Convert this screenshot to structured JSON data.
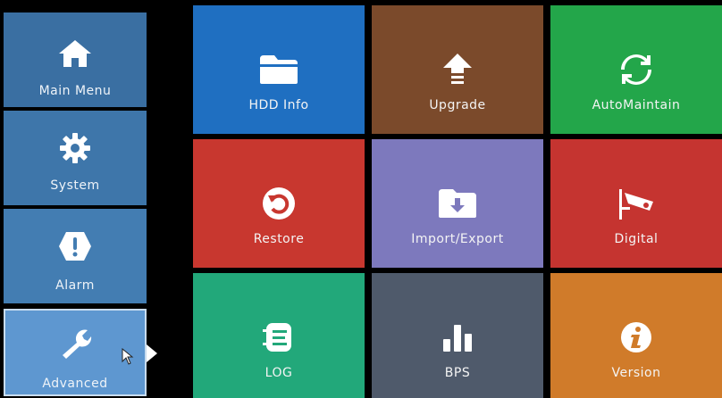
{
  "sidebar": {
    "items": [
      {
        "label": "Main Menu",
        "icon": "home-icon",
        "color": "#3a6fa2"
      },
      {
        "label": "System",
        "icon": "gear-icon",
        "color": "#3e76aa"
      },
      {
        "label": "Alarm",
        "icon": "alert-icon",
        "color": "#437db2"
      },
      {
        "label": "Advanced",
        "icon": "wrench-icon",
        "color": "#5e97d0",
        "active": true
      }
    ]
  },
  "tiles": [
    {
      "label": "HDD Info",
      "icon": "folder-icon",
      "color": "#1f6fc1"
    },
    {
      "label": "Upgrade",
      "icon": "upgrade-arrow-icon",
      "color": "#7b4a2b"
    },
    {
      "label": "AutoMaintain",
      "icon": "refresh-icon",
      "color": "#23a64a"
    },
    {
      "label": "Restore",
      "icon": "restore-icon",
      "color": "#c8372f"
    },
    {
      "label": "Import/Export",
      "icon": "import-export-icon",
      "color": "#7d79bd"
    },
    {
      "label": "Digital",
      "icon": "camera-icon",
      "color": "#c53430"
    },
    {
      "label": "LOG",
      "icon": "log-icon",
      "color": "#22a87a"
    },
    {
      "label": "BPS",
      "icon": "bar-chart-icon",
      "color": "#4f5a6b"
    },
    {
      "label": "Version",
      "icon": "info-icon",
      "color": "#d07b2a"
    }
  ]
}
